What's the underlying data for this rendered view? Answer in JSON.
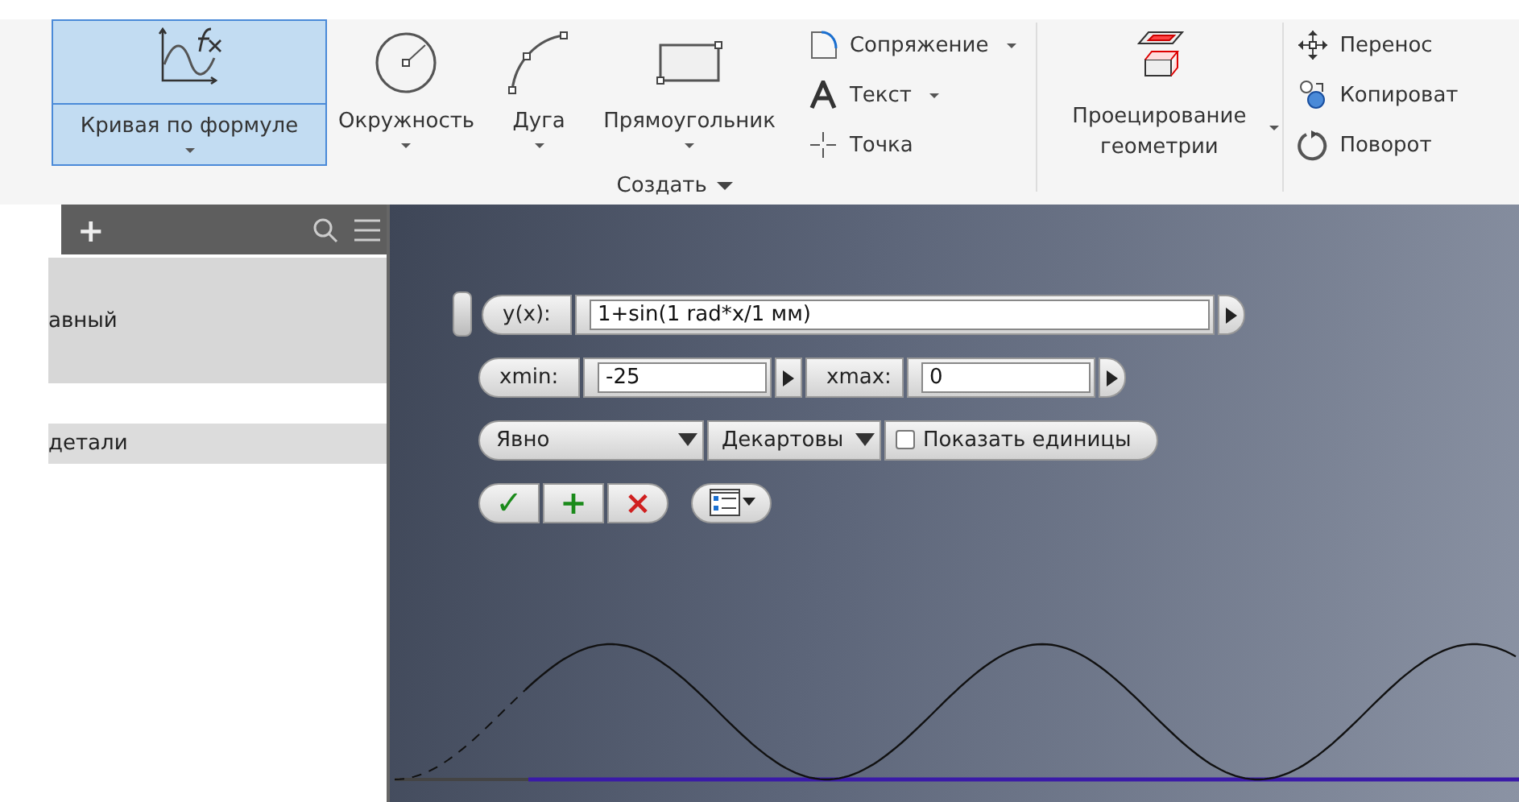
{
  "ribbon": {
    "formula_button": {
      "label": "Кривая по формуле",
      "selected": true
    },
    "tools": [
      {
        "kind": "circle",
        "label": "Окружность"
      },
      {
        "kind": "arc",
        "label": "Дуга"
      },
      {
        "kind": "rect",
        "label": "Прямоугольник"
      }
    ],
    "small_tools": [
      {
        "kind": "fillet",
        "label": "Сопряжение",
        "dropdown": true
      },
      {
        "kind": "text",
        "label": "Текст",
        "dropdown": true
      },
      {
        "kind": "point",
        "label": "Точка",
        "dropdown": false
      }
    ],
    "project_button": {
      "label": "Проецирование геометрии"
    },
    "modify_tools": [
      {
        "kind": "move",
        "label": "Перенос"
      },
      {
        "kind": "copy",
        "label": "Копироват"
      },
      {
        "kind": "rotate",
        "label": "Поворот"
      }
    ],
    "panel_label": "Создать"
  },
  "browser": {
    "add": "+",
    "items": [
      {
        "label": "авный",
        "selected": true
      },
      {
        "label": "детали",
        "selected": true
      }
    ]
  },
  "formula_dialog": {
    "y_label": "y(x):",
    "y_value": "1+sin(1 rad*x/1 мм)",
    "xmin_label": "xmin:",
    "xmin_value": "-25",
    "xmax_label": "xmax:",
    "xmax_value": "0",
    "mode": "Явно",
    "coords": "Декартовы",
    "show_units": {
      "label": "Показать единицы",
      "checked": false
    },
    "actions": [
      {
        "kind": "ok",
        "glyph": "✓"
      },
      {
        "kind": "add",
        "glyph": "+"
      },
      {
        "kind": "cancel",
        "glyph": "×"
      }
    ]
  }
}
